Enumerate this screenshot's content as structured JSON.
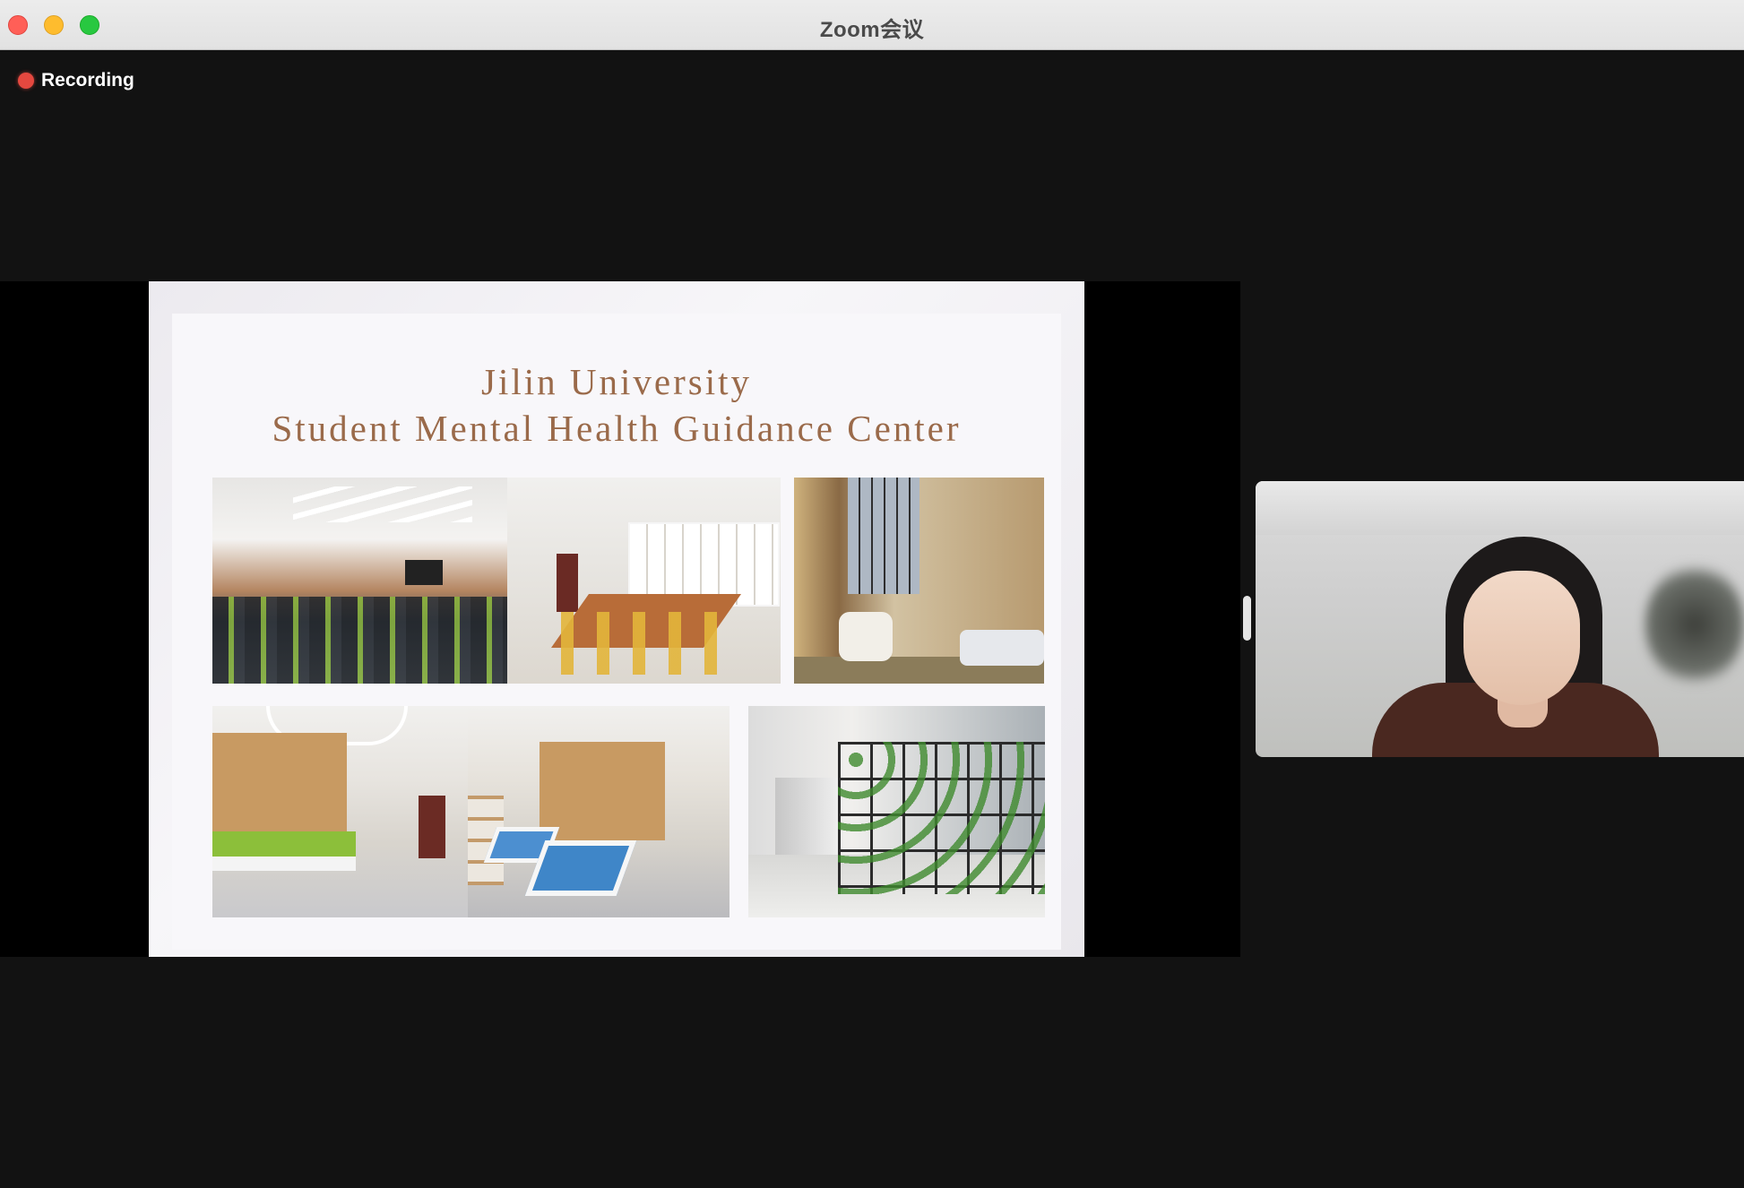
{
  "window": {
    "title": "Zoom会议",
    "controls": {
      "close": "close-button",
      "minimize": "minimize-button",
      "maximize": "maximize-button"
    }
  },
  "recording": {
    "label": "Recording",
    "color": "#e5483f"
  },
  "shared_screen": {
    "slide": {
      "title_line1": "Jilin University",
      "title_line2": "Student Mental Health Guidance Center",
      "title_color": "#9a6a4a",
      "photos": [
        "lecture-room-photo",
        "meeting-room-photo",
        "counseling-room-photo",
        "group-activity-room-photo",
        "sandplay-room-photo",
        "corridor-plants-photo"
      ]
    }
  },
  "participant_video": {
    "description_icon": "participant-video"
  }
}
